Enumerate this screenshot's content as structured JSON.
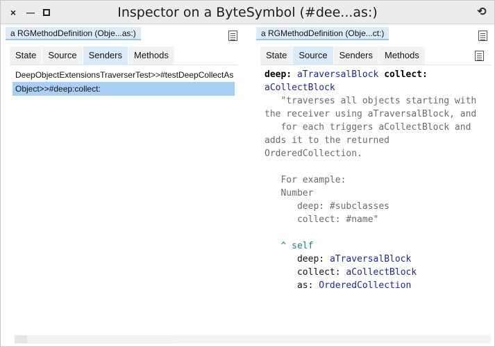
{
  "window": {
    "title": "Inspector on a ByteSymbol (#dee...as:)",
    "controls": {
      "close": "×",
      "minimize": "▬",
      "menu": "⟲"
    }
  },
  "left_pane": {
    "label": "a RGMethodDefinition (Obje...as:)",
    "tabs": [
      {
        "label": "State",
        "active": false
      },
      {
        "label": "Source",
        "active": false
      },
      {
        "label": "Senders",
        "active": true
      },
      {
        "label": "Methods",
        "active": false
      }
    ],
    "items": [
      {
        "text": "DeepObjectExtensionsTraverserTest>>#testDeepCollectAs",
        "selected": false
      },
      {
        "text": "Object>>#deep:collect:",
        "selected": true
      }
    ]
  },
  "right_pane": {
    "label": "a RGMethodDefinition (Obje...ct:)",
    "tabs": [
      {
        "label": "State",
        "active": false
      },
      {
        "label": "Source",
        "active": true
      },
      {
        "label": "Senders",
        "active": false
      },
      {
        "label": "Methods",
        "active": false
      }
    ],
    "source": {
      "sig_kw1": "deep:",
      "sig_arg1": "aTraversalBlock",
      "sig_kw2": "collect:",
      "sig_arg2": "aCollectBlock",
      "comment_lines": [
        "   \"traverses all objects starting with",
        "the receiver using aTraversalBlock, and",
        "   for each triggers aCollectBlock and",
        "adds it to the returned",
        "OrderedCollection.",
        "",
        "   For example:",
        "   Number",
        "      deep: #subclasses",
        "      collect: #name\""
      ],
      "ret_caret": "^",
      "ret_self": "self",
      "body": [
        {
          "kw": "deep:",
          "arg": "aTraversalBlock"
        },
        {
          "kw": "collect:",
          "arg": "aCollectBlock"
        },
        {
          "kw": "as:",
          "arg": "OrderedCollection"
        }
      ]
    }
  }
}
